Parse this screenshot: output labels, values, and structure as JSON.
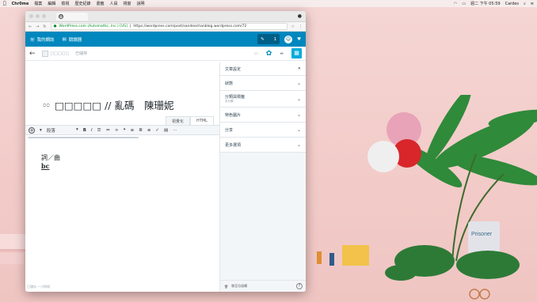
{
  "menubar": {
    "app": "Chr0me",
    "items": [
      "檔案",
      "編輯",
      "檢視",
      "歷史紀錄",
      "書籤",
      "人員",
      "視窗",
      "說明"
    ],
    "clock": "週二 下午 05:59",
    "user": "Cardes"
  },
  "browser": {
    "url_company": "WordPress.com (Automattic, Inc.) [US]",
    "url_sep": "|",
    "url_path": "https://wordpress.com/post/sandeechanblog.wordpress.com/72"
  },
  "masterbar": {
    "my_sites": "我的網誌",
    "reader": "閱讀器",
    "write_count": "1"
  },
  "editor_top": {
    "site_name": "□□□□□",
    "status": "已儲存"
  },
  "editor": {
    "title_prefix": "ᴑᴑ",
    "title": "□□□□□ // 亂碼　陳珊妮",
    "tab_visual": "視覺化",
    "tab_html": "HTML",
    "paragraph_format": "段落",
    "body_line1": "詞／曲",
    "body_line2": "bc",
    "footer": "已儲存 一小時前"
  },
  "sidebar": {
    "header": "文章設定",
    "sections": [
      {
        "label": "狀態"
      },
      {
        "label": "分類與標籤",
        "sub": "未分類"
      },
      {
        "label": "特色圖片"
      },
      {
        "label": "分享"
      },
      {
        "label": "更多選項"
      }
    ],
    "trash": "移至垃圾桶"
  },
  "colors": {
    "masterbar": "#0087be",
    "accent": "#00aadc",
    "wallpaper": "#f3cfcd"
  }
}
